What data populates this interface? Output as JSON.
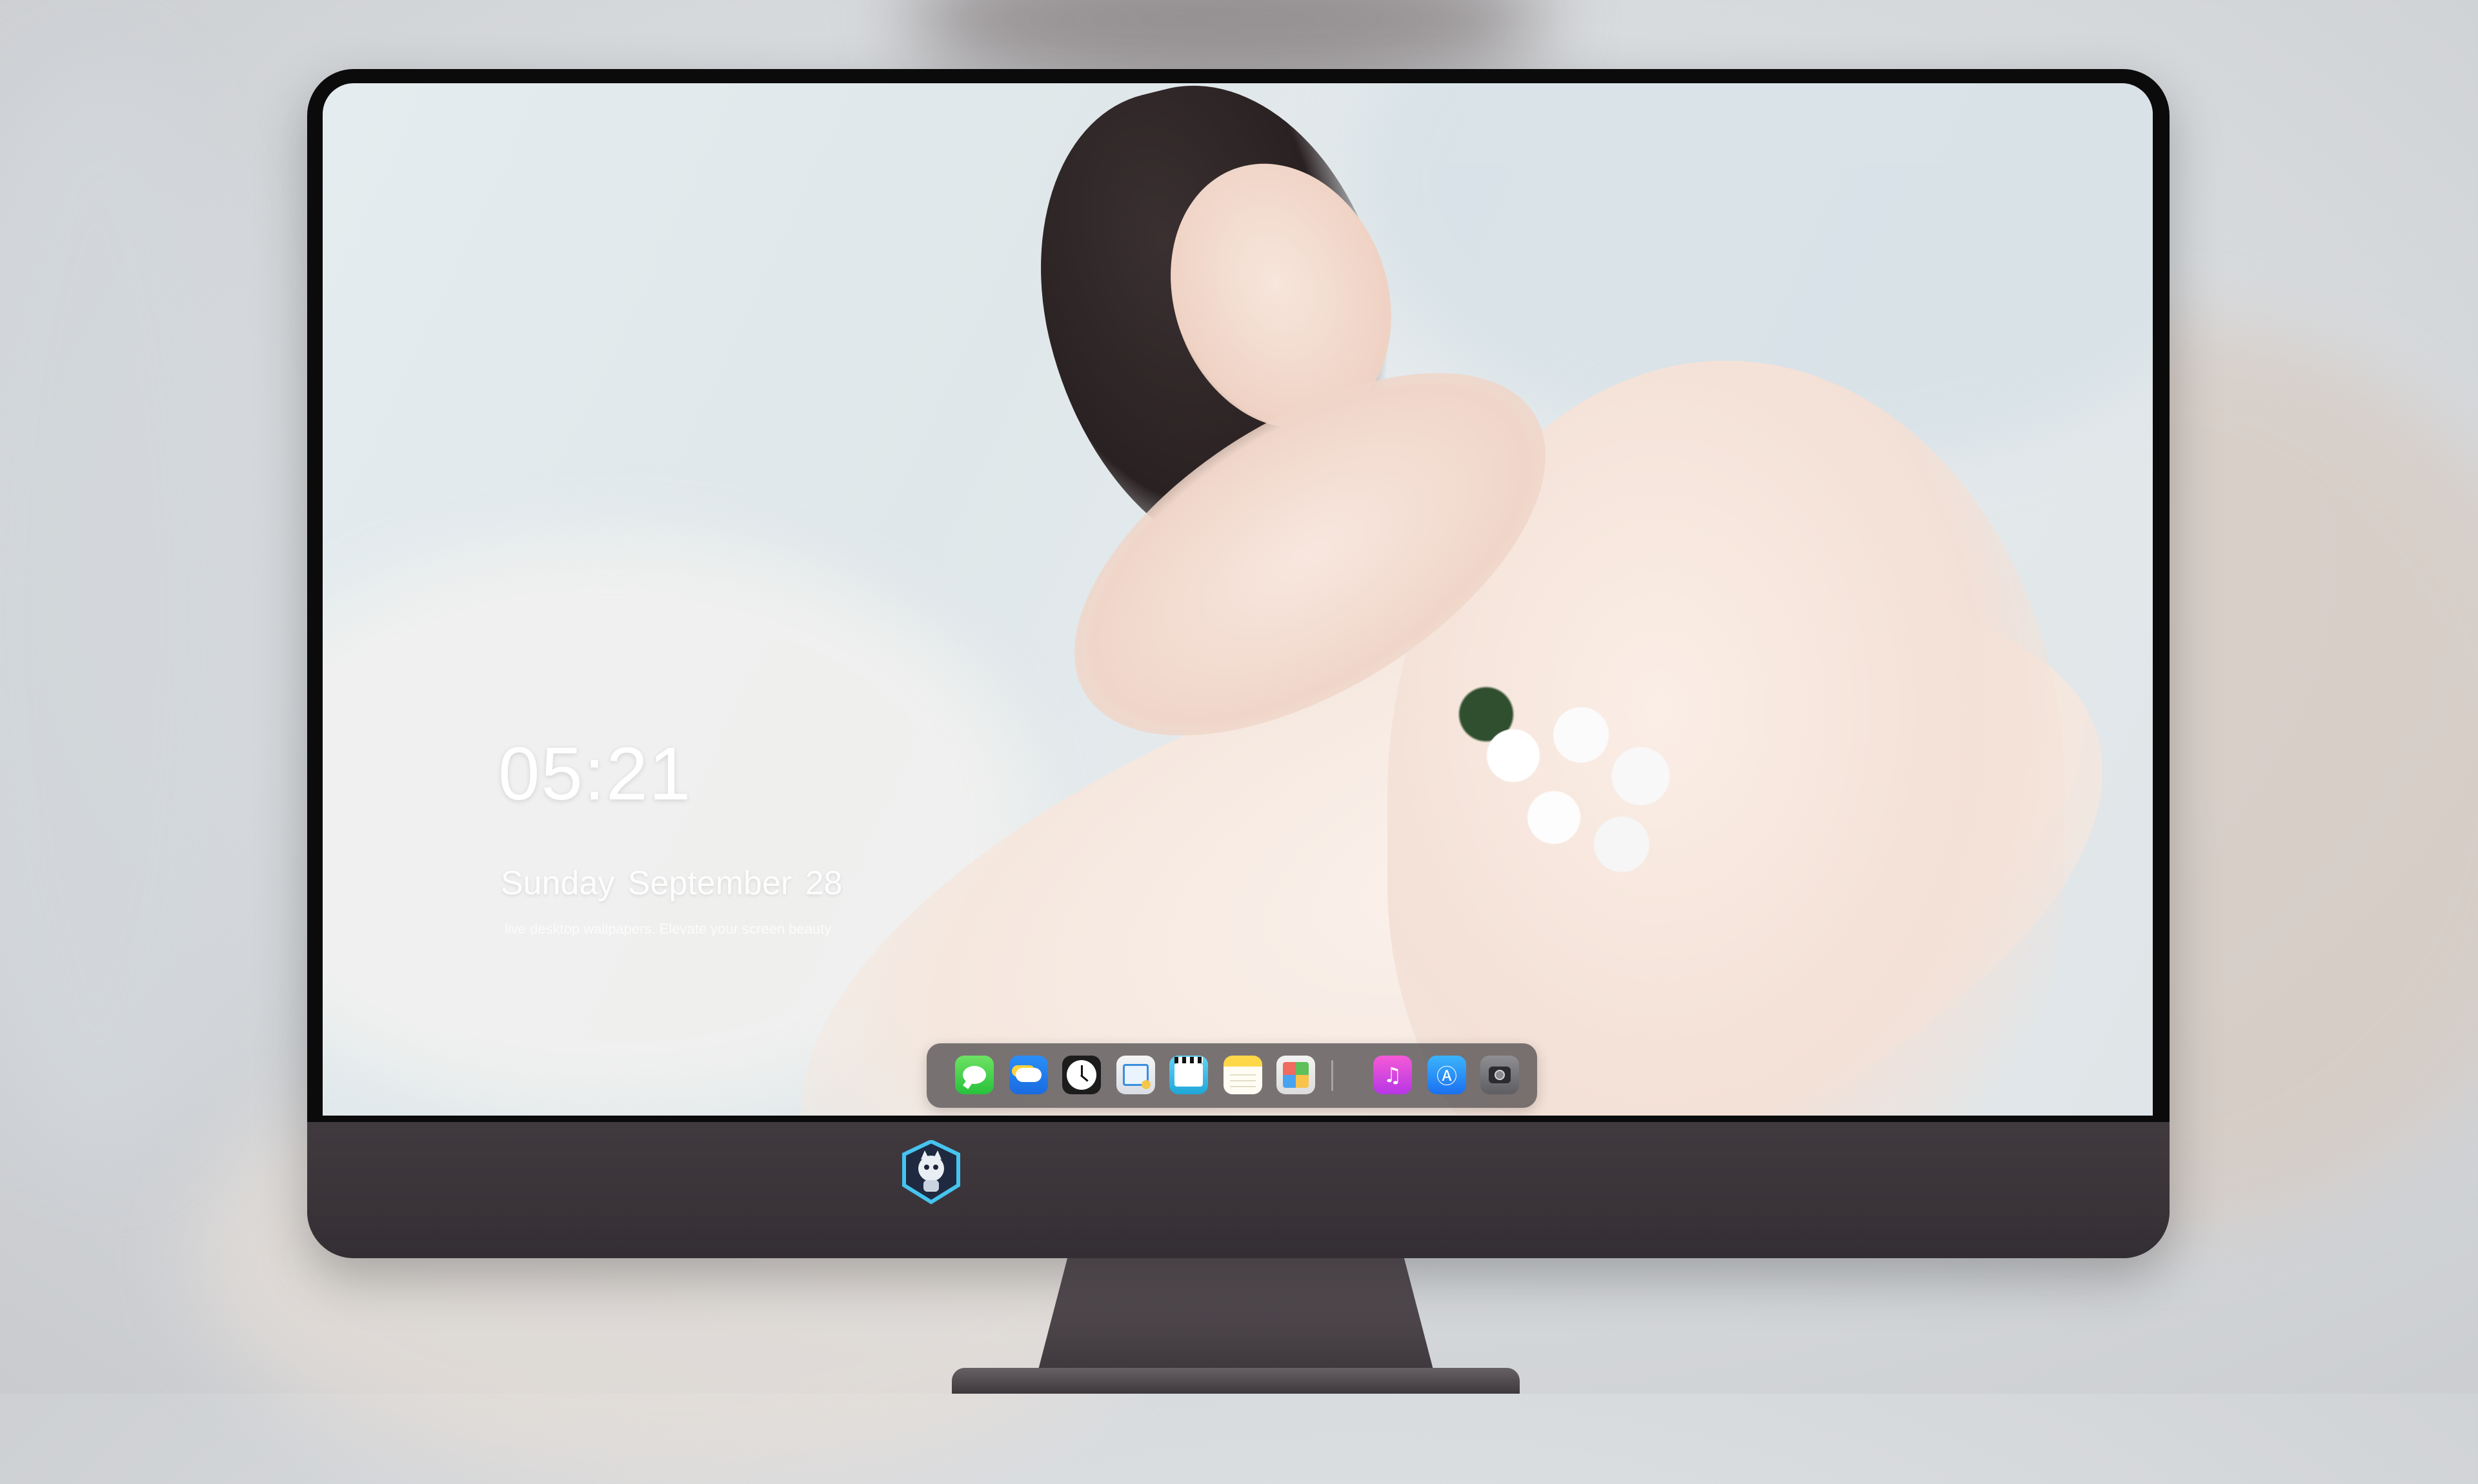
{
  "lockscreen": {
    "time": "05:21",
    "date": "Sunday September  28",
    "tagline": "live desktop wallpapers. Elevate your screen beauty"
  },
  "dock": {
    "apps": [
      {
        "name": "Messages",
        "icon": "messages-icon"
      },
      {
        "name": "Weather",
        "icon": "weather-icon"
      },
      {
        "name": "Clock",
        "icon": "clock-icon"
      },
      {
        "name": "Preview",
        "icon": "preview-icon"
      },
      {
        "name": "Video",
        "icon": "video-icon"
      },
      {
        "name": "Notes",
        "icon": "notes-icon"
      },
      {
        "name": "Photos",
        "icon": "photos-icon"
      },
      {
        "name": "Music",
        "icon": "music-icon"
      },
      {
        "name": "App Store",
        "icon": "app-store-icon"
      },
      {
        "name": "Camera",
        "icon": "camera-icon"
      }
    ]
  },
  "colors": {
    "monitor_bezel": "#0b0b0c",
    "monitor_chin": "#3a3439",
    "dock_background": "#464446",
    "clock_text": "#ffffff"
  }
}
